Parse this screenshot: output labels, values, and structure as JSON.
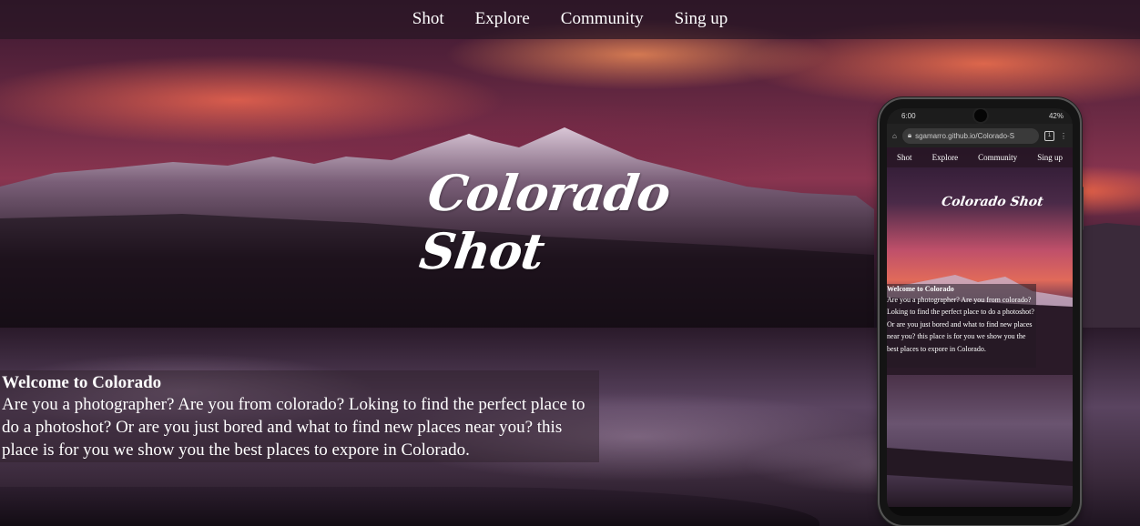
{
  "nav": {
    "items": [
      {
        "label": "Shot"
      },
      {
        "label": "Explore"
      },
      {
        "label": "Community"
      },
      {
        "label": "Sing up"
      }
    ]
  },
  "hero": {
    "title": "Colorado Shot"
  },
  "welcome": {
    "heading": "Welcome to Colorado",
    "body": "Are you a photographer? Are you from colorado? Loking to find the perfect place to do a photoshot? Or are you just bored and what to find new places near you? this place is for you we show you the best places to expore in Colorado."
  },
  "phone": {
    "status_time": "6:00",
    "status_battery": "42%",
    "url": "sgamarro.github.io/Colorado-S",
    "tab_count": "1",
    "nav": [
      {
        "label": "Shot"
      },
      {
        "label": "Explore"
      },
      {
        "label": "Community"
      },
      {
        "label": "Sing up"
      }
    ],
    "title": "Colorado Shot",
    "welcome_heading": "Welcome to Colorado",
    "welcome_body": "Are you a photographer? Are you from colorado? Loking to find the perfect place to do a photoshot? Or are you just bored and what to find new places near you? this place is for you we show you the best places to expore in Colorado."
  },
  "colors": {
    "navbar_bg": "#281624",
    "sunset": "#ff6e50",
    "snow": "#c8aac8"
  }
}
